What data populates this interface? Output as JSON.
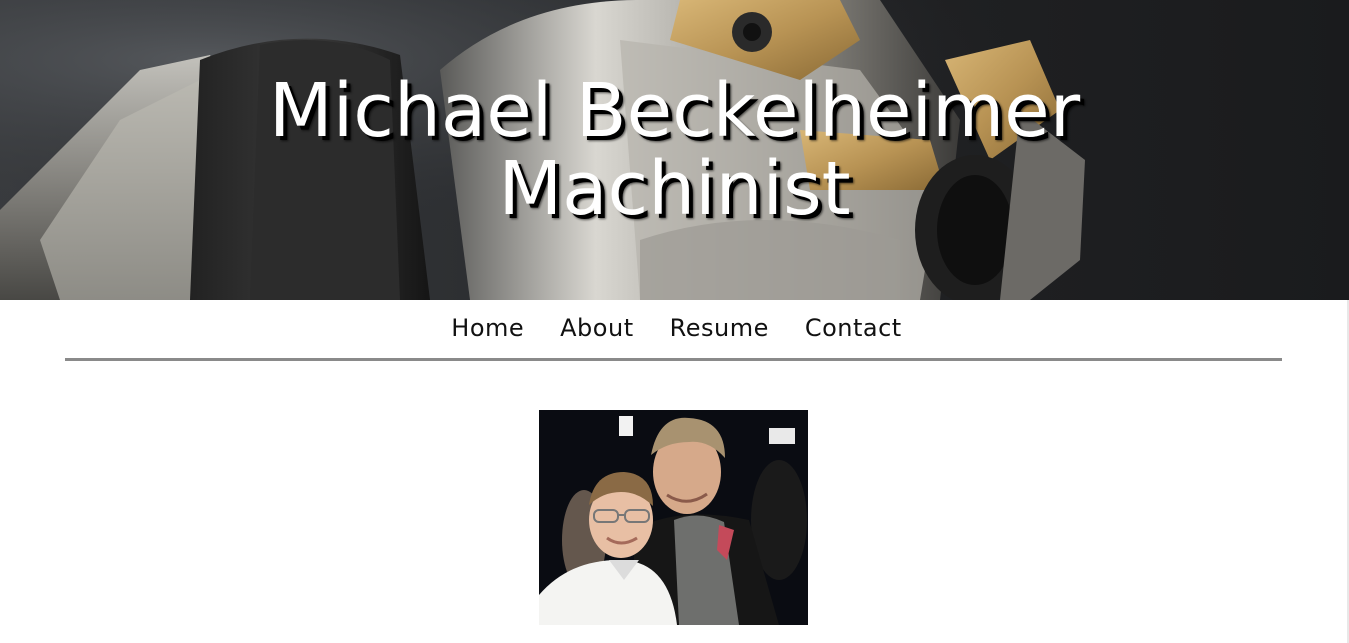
{
  "header": {
    "title_line1": "Michael Beckelheimer",
    "title_line2": "Machinist",
    "banner_image": "lathe-tool-holder-photo"
  },
  "nav": {
    "items": [
      {
        "label": "Home"
      },
      {
        "label": "About"
      },
      {
        "label": "Resume"
      },
      {
        "label": "Contact"
      }
    ]
  },
  "main": {
    "photo": "two-people-portrait-photo"
  },
  "colors": {
    "divider": "#8a8a8a",
    "title_text": "#ffffff",
    "nav_text": "#111111"
  }
}
